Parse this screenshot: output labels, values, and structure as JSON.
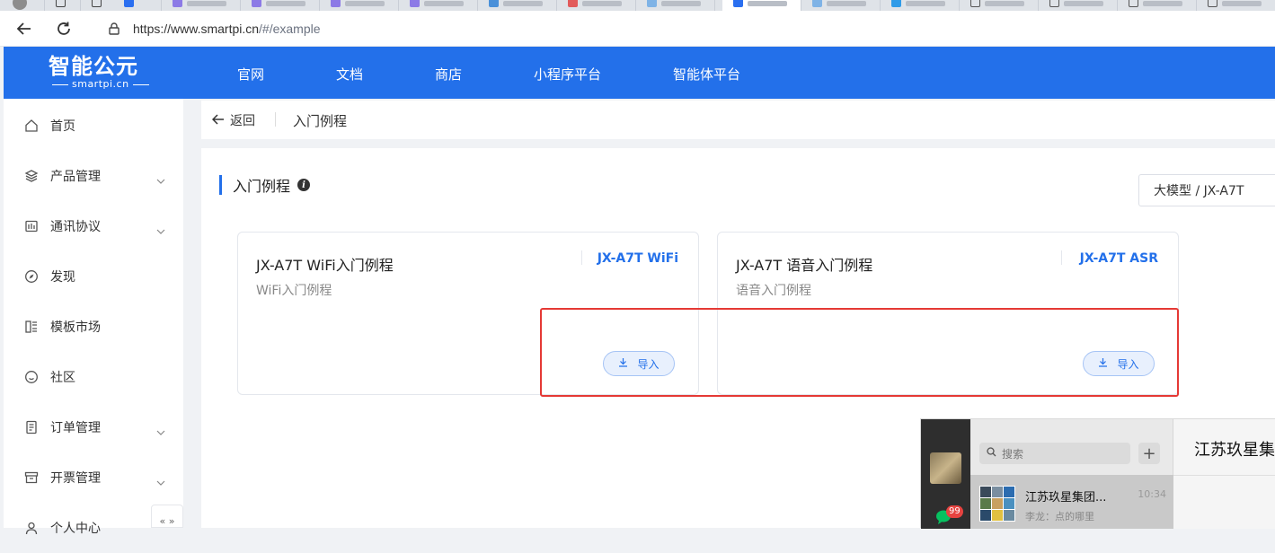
{
  "browser": {
    "url_host": "https://www.smartpi.cn",
    "url_path": "/#/example"
  },
  "topnav": {
    "logo_name": "智能公元",
    "logo_sub": "smartpi.cn",
    "items": [
      "官网",
      "文档",
      "商店",
      "小程序平台",
      "智能体平台"
    ]
  },
  "sidebar": {
    "items": [
      {
        "label": "首页",
        "icon": "home-icon",
        "expandable": false
      },
      {
        "label": "产品管理",
        "icon": "layers-icon",
        "expandable": true
      },
      {
        "label": "通讯协议",
        "icon": "protocol-icon",
        "expandable": true
      },
      {
        "label": "发现",
        "icon": "compass-icon",
        "expandable": false
      },
      {
        "label": "模板市场",
        "icon": "template-icon",
        "expandable": false
      },
      {
        "label": "社区",
        "icon": "smile-icon",
        "expandable": false
      },
      {
        "label": "订单管理",
        "icon": "document-icon",
        "expandable": true
      },
      {
        "label": "开票管理",
        "icon": "archive-icon",
        "expandable": true
      },
      {
        "label": "个人中心",
        "icon": "user-icon",
        "expandable": false
      }
    ]
  },
  "breadcrumb": {
    "back_label": "返回",
    "title": "入门例程"
  },
  "main": {
    "section_title": "入门例程",
    "selector_value": "大模型 / JX-A7T",
    "cards": [
      {
        "title": "JX-A7T WiFi入门例程",
        "desc": "WiFi入门例程",
        "tag": "JX-A7T WiFi",
        "button": "导入"
      },
      {
        "title": "JX-A7T 语音入门例程",
        "desc": "语音入门例程",
        "tag": "JX-A7T ASR",
        "button": "导入"
      }
    ]
  },
  "chat": {
    "search_placeholder": "搜索",
    "badge_count": "99",
    "conversation": {
      "name": "江苏玖星集团...",
      "time": "10:34",
      "preview": "李龙：点的哪里"
    },
    "window_title": "江苏玖星集"
  },
  "colors": {
    "accent": "#2370ea",
    "highlight_box": "#e53935"
  }
}
